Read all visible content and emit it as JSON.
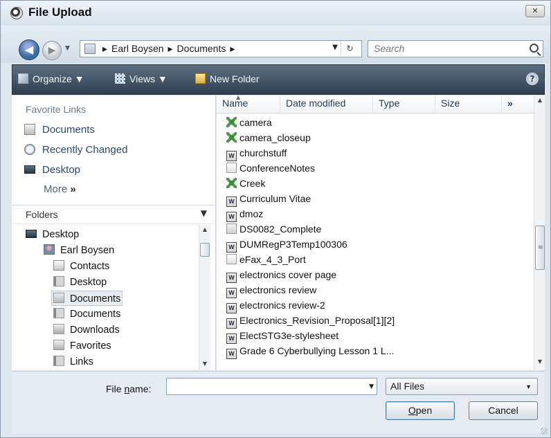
{
  "window": {
    "title": "File Upload",
    "close_label": "✕"
  },
  "nav": {
    "back_glyph": "◀",
    "forward_glyph": "▶",
    "history_glyph": "▼",
    "breadcrumbs": [
      "▸",
      "Earl Boysen",
      "▸",
      "Documents",
      "▸"
    ],
    "address_drop_glyph": "▼",
    "refresh_glyph": "↻",
    "search_placeholder": "Search"
  },
  "toolbar": {
    "organize_label": "Organize ▼",
    "views_label": "Views ▼",
    "new_folder_label": "New Folder",
    "help_label": "?"
  },
  "favorites": {
    "title": "Favorite Links",
    "items": [
      {
        "label": "Documents",
        "icon": "documents-icon"
      },
      {
        "label": "Recently Changed",
        "icon": "recently-changed-icon"
      },
      {
        "label": "Desktop",
        "icon": "desktop-icon"
      }
    ],
    "more_label": "More",
    "more_glyph": "»"
  },
  "folders": {
    "title": "Folders",
    "chevron": "▼",
    "tree": [
      {
        "label": "Desktop",
        "icon": "desktop-icon"
      },
      {
        "label": "Earl Boysen",
        "icon": "user-icon"
      },
      {
        "label": "Contacts",
        "icon": "contacts-icon"
      },
      {
        "label": "Desktop",
        "icon": "folder-icon"
      },
      {
        "label": "Documents",
        "icon": "documents-folder-icon",
        "selected": true
      },
      {
        "label": "Documents",
        "icon": "folder-icon"
      },
      {
        "label": "Downloads",
        "icon": "downloads-icon"
      },
      {
        "label": "Favorites",
        "icon": "favorites-icon"
      },
      {
        "label": "Links",
        "icon": "folder-icon"
      }
    ]
  },
  "columns": {
    "name": "Name",
    "date_modified": "Date modified",
    "type": "Type",
    "size": "Size",
    "more": "»"
  },
  "files": [
    {
      "name": "camera",
      "icon": "image-icon"
    },
    {
      "name": "camera_closeup",
      "icon": "image-icon"
    },
    {
      "name": "churchstuff",
      "icon": "word-icon"
    },
    {
      "name": "ConferenceNotes",
      "icon": "document-icon"
    },
    {
      "name": "Creek",
      "icon": "image-icon"
    },
    {
      "name": "Curriculum Vitae",
      "icon": "word-icon"
    },
    {
      "name": "dmoz",
      "icon": "word-icon"
    },
    {
      "name": "DS0082_Complete",
      "icon": "pdf-icon"
    },
    {
      "name": "DUMRegP3Temp100306",
      "icon": "word-icon"
    },
    {
      "name": "eFax_4_3_Port",
      "icon": "document-icon"
    },
    {
      "name": "electronics cover page",
      "icon": "word-icon"
    },
    {
      "name": "electronics review",
      "icon": "word-icon"
    },
    {
      "name": "electronics review-2",
      "icon": "word-icon"
    },
    {
      "name": "Electronics_Revision_Proposal[1][2]",
      "icon": "word-icon"
    },
    {
      "name": "ElectSTG3e-stylesheet",
      "icon": "word-icon"
    },
    {
      "name": "Grade 6 Cyberbullying Lesson 1 L...",
      "icon": "word-icon"
    }
  ],
  "footer": {
    "file_name_label_prefix": "File ",
    "file_name_label_accel": "n",
    "file_name_label_suffix": "ame:",
    "file_name_value": "",
    "file_type_selected": "All Files",
    "open_accel": "O",
    "open_rest": "pen",
    "cancel_label": "Cancel"
  },
  "colors": {
    "toolbar_bg": "#2f3f50",
    "link_text": "#2a4a6b",
    "accent": "#3c7fb1"
  }
}
